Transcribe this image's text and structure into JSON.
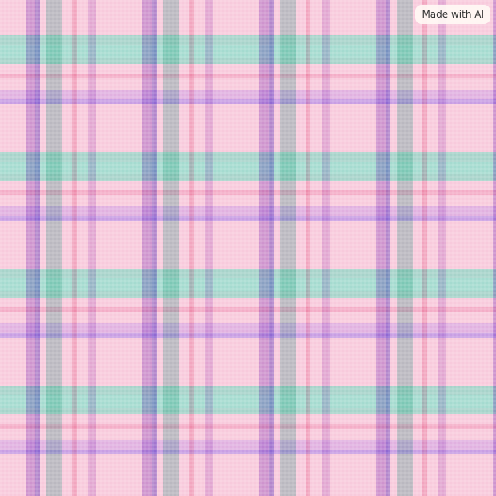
{
  "image": {
    "description_colors": {
      "base": "#f8cadc",
      "mint": "#8cd6c4",
      "lavender": "#ce9ce4",
      "violet": "#a08ce6",
      "rose": "#ee78a0"
    }
  },
  "badge": {
    "label": "Made with AI"
  }
}
